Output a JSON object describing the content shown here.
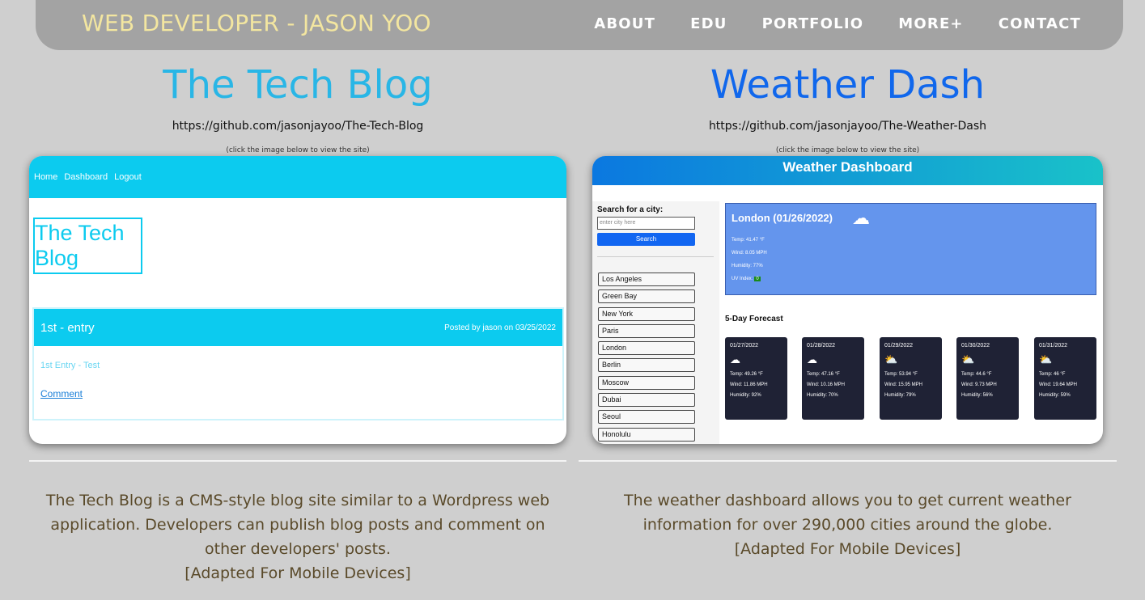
{
  "navbar": {
    "brand": "WEB DEVELOPER - JASON YOO",
    "links": [
      "ABOUT",
      "EDU",
      "PORTFOLIO",
      "MORE+",
      "CONTACT"
    ]
  },
  "projects": [
    {
      "title": "The Tech Blog",
      "url": "https://github.com/jasonjayoo/The-Tech-Blog",
      "hint": "(click the image below to view the site)",
      "description": "The Tech Blog is a CMS-style blog site similar to a Wordpress web application. Developers can publish blog posts and comment on other developers' posts.",
      "note": "[Adapted For Mobile Devices]",
      "preview": {
        "nav": [
          "Home",
          "Dashboard",
          "Logout"
        ],
        "logo": "The Tech Blog",
        "post_title": "1st - entry",
        "post_meta": "Posted by jason on 03/25/2022",
        "post_body": "1st Entry - Test",
        "comment_link": "Comment"
      }
    },
    {
      "title": "Weather Dash",
      "url": "https://github.com/jasonjayoo/The-Weather-Dash",
      "hint": "(click the image below to view the site)",
      "description": "The weather dashboard allows you to get current weather information for over 290,000 cities around the globe.",
      "note": "[Adapted For Mobile Devices]",
      "preview": {
        "header": "Weather Dashboard",
        "search_label": "Search for a city:",
        "search_placeholder": "enter city here",
        "search_button": "Search",
        "cities": [
          "Los Angeles",
          "Green Bay",
          "New York",
          "Paris",
          "London",
          "Berlin",
          "Moscow",
          "Dubai",
          "Seoul",
          "Honolulu"
        ],
        "current": {
          "title": "London (01/26/2022)",
          "temp": "Temp: 41.47 °F",
          "wind": "Wind: 8.05 MPH",
          "humidity": "Humidity: 77%",
          "uv_label": "UV Index:",
          "uv_value": "0"
        },
        "forecast_title": "5-Day Forecast",
        "forecast": [
          {
            "date": "01/27/2022",
            "icon": "cloud-icon",
            "temp": "Temp: 49.26 °F",
            "wind": "Wind: 11.86 MPH",
            "humidity": "Humidity: 92%"
          },
          {
            "date": "01/28/2022",
            "icon": "cloud-icon",
            "temp": "Temp: 47.16 °F",
            "wind": "Wind: 10.16 MPH",
            "humidity": "Humidity: 70%"
          },
          {
            "date": "01/29/2022",
            "icon": "sun-cloud-icon",
            "temp": "Temp: 53.94 °F",
            "wind": "Wind: 15.95 MPH",
            "humidity": "Humidity: 79%"
          },
          {
            "date": "01/30/2022",
            "icon": "sun-cloud-icon",
            "temp": "Temp: 44.6 °F",
            "wind": "Wind: 9.73 MPH",
            "humidity": "Humidity: 56%"
          },
          {
            "date": "01/31/2022",
            "icon": "sun-cloud-icon",
            "temp": "Temp: 46 °F",
            "wind": "Wind: 19.64 MPH",
            "humidity": "Humidity: 59%"
          }
        ]
      }
    }
  ]
}
